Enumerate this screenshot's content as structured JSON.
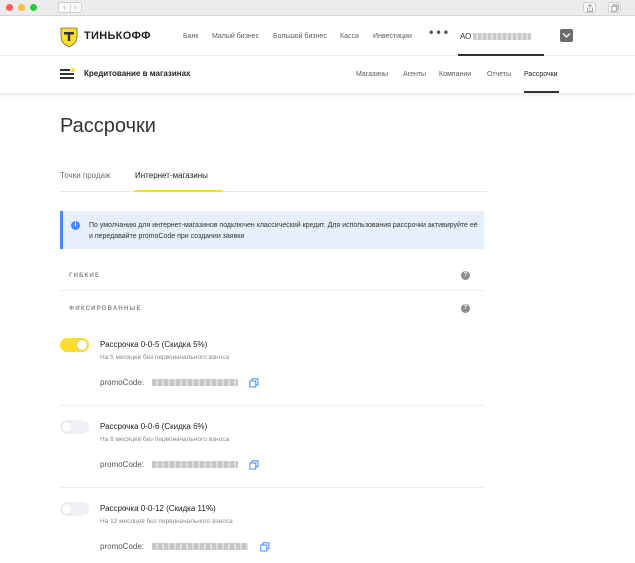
{
  "browser": {
    "nav_back": "‹",
    "nav_forward": "›"
  },
  "header": {
    "brand": "ТИНЬКОФФ",
    "nav": [
      "Банк",
      "Малый бизнес",
      "Большой бизнес",
      "Касса",
      "Инвестиции"
    ],
    "more": "•••",
    "account_prefix": "АО"
  },
  "subheader": {
    "title": "Кредитование в магазинах",
    "nav": [
      "Магазины",
      "Агенты",
      "Компании",
      "Отчеты",
      "Рассрочки"
    ],
    "active": "Рассрочки"
  },
  "page": {
    "title": "Рассрочки",
    "tabs": [
      "Точки продаж",
      "Интернет-магазины"
    ],
    "active_tab": "Интернет-магазины",
    "info_icon": "i",
    "info_text": "По умолчанию для интернет-магазинов подключен классический кредит. Для использования рассрочки активируйте её и передавайте promoCode при создании заявки",
    "groups": [
      "ГИБКИЕ",
      "ФИКСИРОВАННЫЕ"
    ],
    "help_icon": "?",
    "plans": [
      {
        "name": "Рассрочка 0-0-5 (Скидка 5%)",
        "subtitle": "На 5 месяцев без первоначального взноса",
        "promo_label": "promoCode:",
        "enabled": true
      },
      {
        "name": "Рассрочка 0-0-6 (Скидка 6%)",
        "subtitle": "На 6 месяцев без первоначального взноса",
        "promo_label": "promoCode:",
        "enabled": false
      },
      {
        "name": "Рассрочка 0-0-12 (Скидка 11%)",
        "subtitle": "На 12 месяцев без первоначального взноса",
        "promo_label": "promoCode:",
        "enabled": false
      }
    ]
  },
  "colors": {
    "accent_yellow": "#ffdd2d",
    "info_blue": "#428bf9",
    "info_background": "#e6f0fb",
    "toggle_off": "#eef1f6"
  }
}
